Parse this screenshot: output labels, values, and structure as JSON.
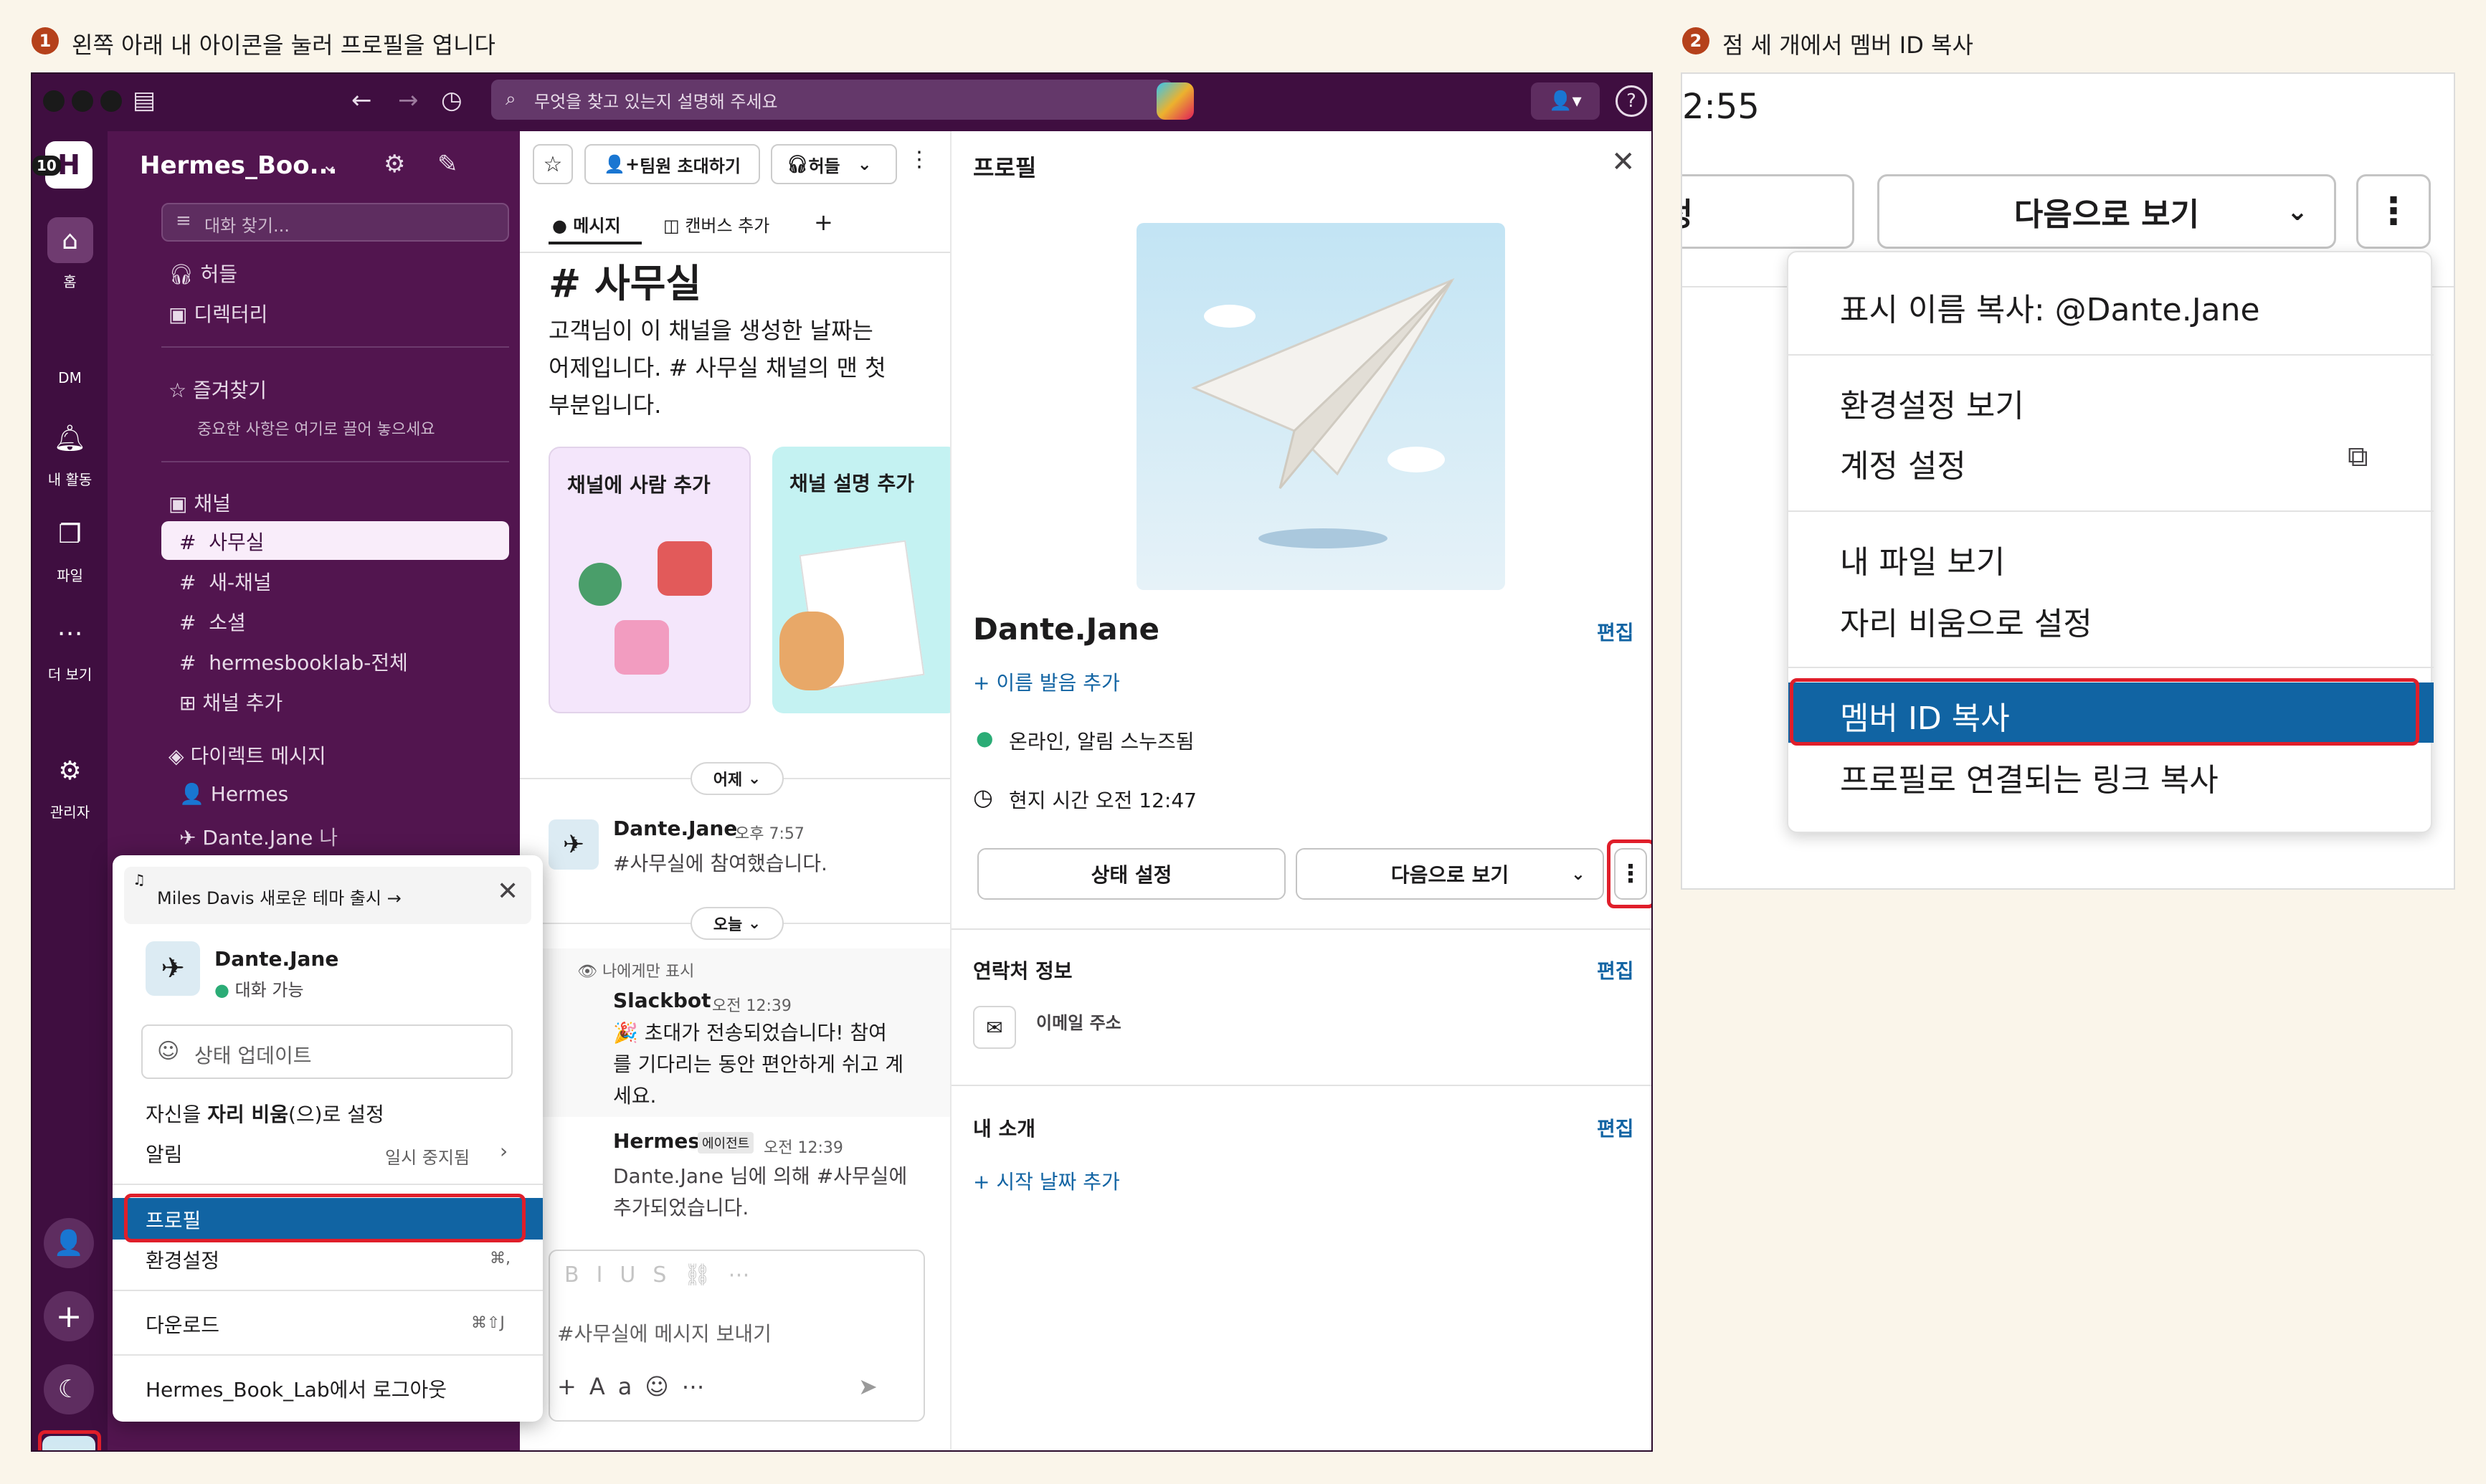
{
  "step1": {
    "num": "1",
    "caption": "왼쪽 아래 내 아이콘을 눌러 프로필을 엽니다"
  },
  "step2": {
    "num": "2",
    "caption": "점 세 개에서 멤버 ID 복사"
  },
  "topbar": {
    "search_placeholder": "무엇을 찾고 있는지 설명해 주세요"
  },
  "rail": {
    "workspace_initial": "H",
    "badge": "10",
    "items": [
      "홈",
      "DM",
      "내 활동",
      "파일",
      "더 보기",
      "관리자"
    ]
  },
  "sidebar": {
    "workspace": "Hermes_Boo...",
    "find_placeholder": "대화 찾기...",
    "huddle": "허들",
    "directory": "디렉터리",
    "favorites": "즐겨찾기",
    "favorites_hint": "중요한 사항은 여기로 끌어 놓으세요",
    "channels_header": "채널",
    "channels": [
      "사무실",
      "새-채널",
      "소셜",
      "hermesbooklab-전체"
    ],
    "add_channel": "채널 추가",
    "dm_header": "다이렉트 메시지",
    "dms": [
      "Hermes",
      "Dante.Jane"
    ],
    "dm_me": "나"
  },
  "channel": {
    "invite_btn": "팀원 초대하기",
    "huddle_btn": "허들",
    "tab_messages": "메시지",
    "tab_canvas": "캔버스 추가",
    "title": "# 사무실",
    "intro": [
      "고객님이 이 채널을 생성한 날짜는",
      "어제입니다. # 사무실 채널의 맨 첫",
      "부분입니다."
    ],
    "card1": "채널에 사람 추가",
    "card2": "채널 설명 추가",
    "day_yesterday": "어제",
    "day_today": "오늘",
    "msg1_name": "Dante.Jane",
    "msg1_time": "오후 7:57",
    "msg1_text": "#사무실에 참여했습니다.",
    "only_you": "나에게만 표시",
    "msg2_name": "Slackbot",
    "msg2_time": "오전 12:39",
    "msg2_text": [
      "🎉 초대가 전송되었습니다! 참여",
      "를 기다리는 동안 편안하게 쉬고 계",
      "세요."
    ],
    "msg3_name": "Hermes",
    "msg3_badge": "에이전트",
    "msg3_time": "오전 12:39",
    "msg3_text": [
      "Dante.Jane 님에 의해 #사무실에",
      "추가되었습니다."
    ],
    "composer_placeholder": "#사무실에 메시지 보내기"
  },
  "profile": {
    "header": "프로필",
    "name": "Dante.Jane",
    "edit": "편집",
    "add_pronunciation": "+ 이름 발음 추가",
    "status": "온라인, 알림 스누즈됨",
    "local_time": "현지 시간 오전 12:47",
    "btn_status": "상태 설정",
    "btn_view_as": "다음으로 보기",
    "contact_header": "연락처 정보",
    "email_label": "이메일 주소",
    "about_header": "내 소개",
    "add_start_date": "+ 시작 날짜 추가"
  },
  "popup": {
    "promo": "Miles Davis 새로운 테마 출시 →",
    "name": "Dante.Jane",
    "status": "대화 가능",
    "update_status": "상태 업데이트",
    "away_prefix": "자신을",
    "away_bold": "자리 비움",
    "away_suffix": "(으)로 설정",
    "notifications": "알림",
    "notifications_value": "일시 중지됨",
    "profile": "프로필",
    "preferences": "환경설정",
    "preferences_shortcut": "⌘,",
    "downloads": "다운로드",
    "downloads_shortcut": "⌘⇧J",
    "logout": "Hermes_Book_Lab에서 로그아웃"
  },
  "zoom": {
    "time": "2:55",
    "left_btn_fragment": "정",
    "btn_view_as": "다음으로 보기",
    "menu": [
      "표시 이름 복사: @Dante.Jane",
      "환경설정 보기",
      "계정 설정",
      "내 파일 보기",
      "자리 비움으로 설정",
      "멤버 ID 복사",
      "프로필로 연결되는 링크 복사"
    ]
  },
  "colors": {
    "aubergine": "#3f0e40",
    "sidebar": "#52154f",
    "highlight": "#e01e2a",
    "selected": "#1164a3",
    "link": "#1264a3"
  }
}
